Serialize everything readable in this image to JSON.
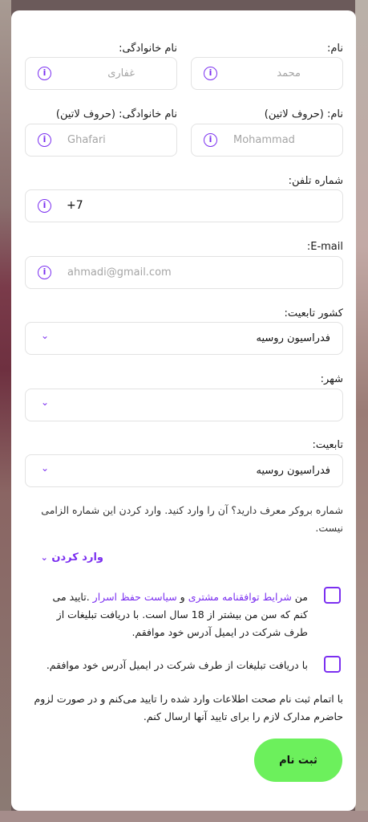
{
  "form": {
    "first_name": {
      "label": "نام:",
      "placeholder": "محمد"
    },
    "last_name": {
      "label": "نام خانوادگی:",
      "placeholder": "غفاری"
    },
    "first_name_latin": {
      "label": "نام: (حروف لاتین)",
      "placeholder": "Mohammad"
    },
    "last_name_latin": {
      "label": "نام خانوادگی: (حروف لاتین)",
      "placeholder": "Ghafari"
    },
    "phone": {
      "label": "شماره تلفن:",
      "value": "+7"
    },
    "email": {
      "label": "E-mail:",
      "placeholder": "ahmadi@gmail.com"
    },
    "country": {
      "label": "کشور تابعیت:",
      "value": "فدراسیون روسیه"
    },
    "city": {
      "label": "شهر:",
      "value": ""
    },
    "citizenship": {
      "label": "تابعیت:",
      "value": "فدراسیون روسیه"
    },
    "referral_note": "شماره بروکر معرف دارید؟ آن را وارد کنید. وارد کردن این شماره الزامی نیست.",
    "enter_link": "وارد کردن",
    "terms": {
      "prefix": "من ",
      "link1": "شرایط توافقنامه مشتری",
      "middle": " و ",
      "link2": "سیاست حفظ اسرار",
      "suffix": " .تایید می کنم که سن من بیشتر از 18 سال است. با دریافت تبلیغات از طرف شرکت در ایمیل آدرس خود موافقم."
    },
    "ads_consent": "با دریافت تبلیغات از طرف شرکت در ایمیل آدرس خود موافقم.",
    "final_note": "با اتمام ثبت نام صحت اطلاعات وارد شده را تایید می‌کنم و در صورت لزوم حاضرم مدارک لازم را برای تایید آنها ارسال کنم.",
    "submit_label": "ثبت نام"
  },
  "icons": {
    "info": "info-icon",
    "dropdown": "chevron-down-icon"
  },
  "colors": {
    "accent": "#7b2ff0",
    "submit": "#6cf05c"
  }
}
